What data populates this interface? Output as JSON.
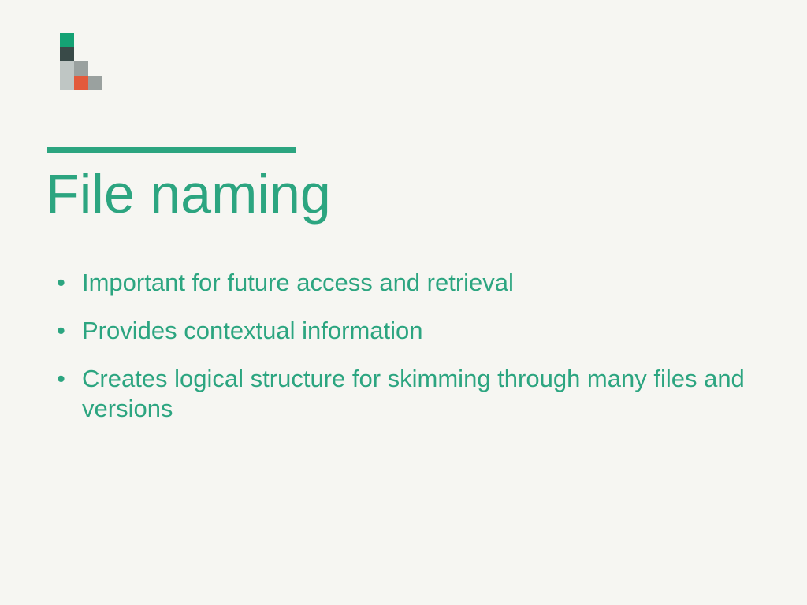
{
  "slide": {
    "title": "File naming",
    "bullets": [
      "Important for future access and retrieval",
      "Provides contextual information",
      "Creates logical structure for skimming through many files and versions"
    ]
  },
  "colors": {
    "accent": "#2ca580",
    "background": "#f6f6f2",
    "logo": {
      "green": "#14a274",
      "dark": "#394a48",
      "grayL": "#bfc6c4",
      "grayD": "#9aa19f",
      "orange": "#e35a3b"
    }
  }
}
